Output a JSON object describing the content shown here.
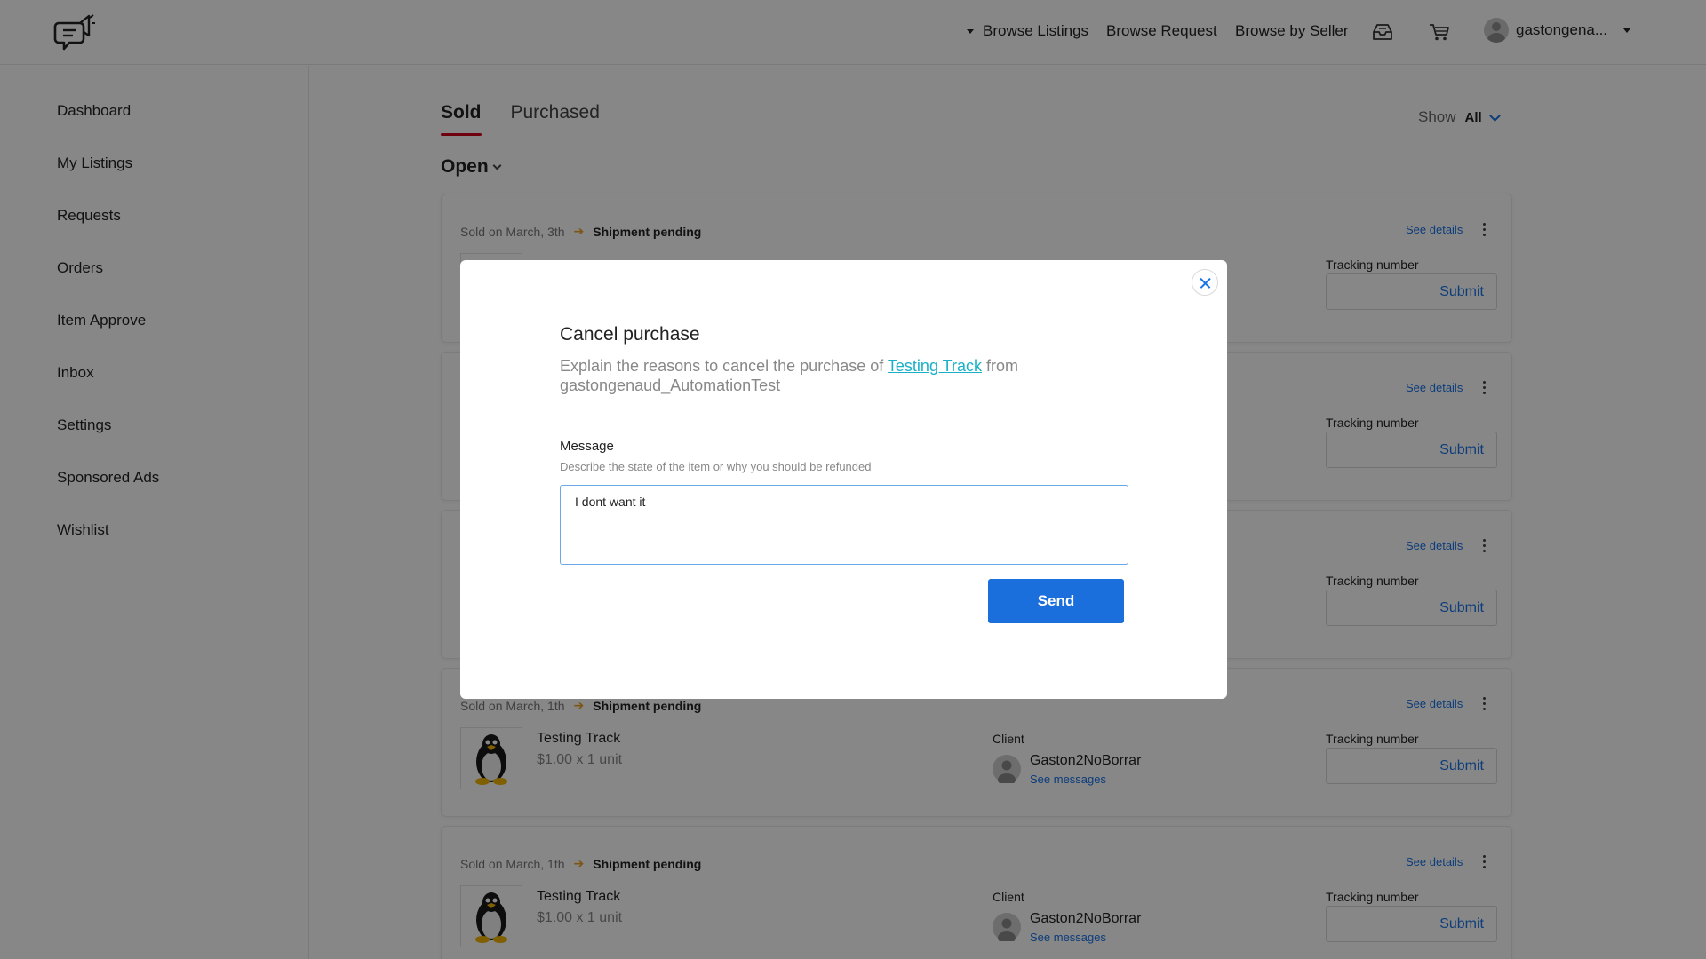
{
  "header": {
    "nav_browse_listings": "Browse Listings",
    "nav_browse_request": "Browse Request",
    "nav_browse_seller": "Browse by Seller",
    "username": "gastongena..."
  },
  "sidebar": {
    "items": [
      {
        "label": "Dashboard"
      },
      {
        "label": "My Listings"
      },
      {
        "label": "Requests"
      },
      {
        "label": "Orders"
      },
      {
        "label": "Item Approve"
      },
      {
        "label": "Inbox"
      },
      {
        "label": "Settings"
      },
      {
        "label": "Sponsored Ads"
      },
      {
        "label": "Wishlist"
      }
    ]
  },
  "main": {
    "tabs": [
      {
        "label": "Sold"
      },
      {
        "label": "Purchased"
      }
    ],
    "show_label": "Show",
    "show_value": "All",
    "filter_label": "Open"
  },
  "cards": [
    {
      "date": "Sold on March, 3th",
      "status": "Shipment pending",
      "see_details": "See details",
      "tracking_label": "Tracking number",
      "submit": "Submit"
    },
    {
      "see_details": "See details",
      "tracking_label": "Tracking number",
      "submit": "Submit"
    },
    {
      "see_details": "See details",
      "tracking_label": "Tracking number",
      "submit": "Submit"
    },
    {
      "date": "Sold on March, 1th",
      "status": "Shipment pending",
      "see_details": "See details",
      "item_name": "Testing Track",
      "item_price": "$1.00 x 1 unit",
      "client_label": "Client",
      "client_name": "Gaston2NoBorrar",
      "see_messages": "See messages",
      "tracking_label": "Tracking number",
      "submit": "Submit"
    },
    {
      "date": "Sold on March, 1th",
      "status": "Shipment pending",
      "see_details": "See details",
      "item_name": "Testing Track",
      "item_price": "$1.00 x 1 unit",
      "client_label": "Client",
      "client_name": "Gaston2NoBorrar",
      "see_messages": "See messages",
      "tracking_label": "Tracking number",
      "submit": "Submit"
    }
  ],
  "modal": {
    "title": "Cancel purchase",
    "desc_prefix": "Explain the reasons to cancel the purchase of",
    "desc_link": "Testing Track",
    "desc_from": "from",
    "desc_seller": "gastongenaud_AutomationTest",
    "message_label": "Message",
    "message_hint": "Describe the state of the item or why you should be refunded",
    "message_value": "I dont want it",
    "send_label": "Send"
  },
  "colors": {
    "accent": "#1a6fdc",
    "tab_underline": "#d6001c",
    "link": "#1ab0c8",
    "status_arrow": "#e8a020"
  },
  "icons": [
    "megaphone-chat-logo",
    "inbox-icon",
    "cart-icon",
    "user-avatar-icon",
    "chevron-down-icon",
    "kebab-menu-icon",
    "close-icon",
    "penguin-thumbnail"
  ]
}
